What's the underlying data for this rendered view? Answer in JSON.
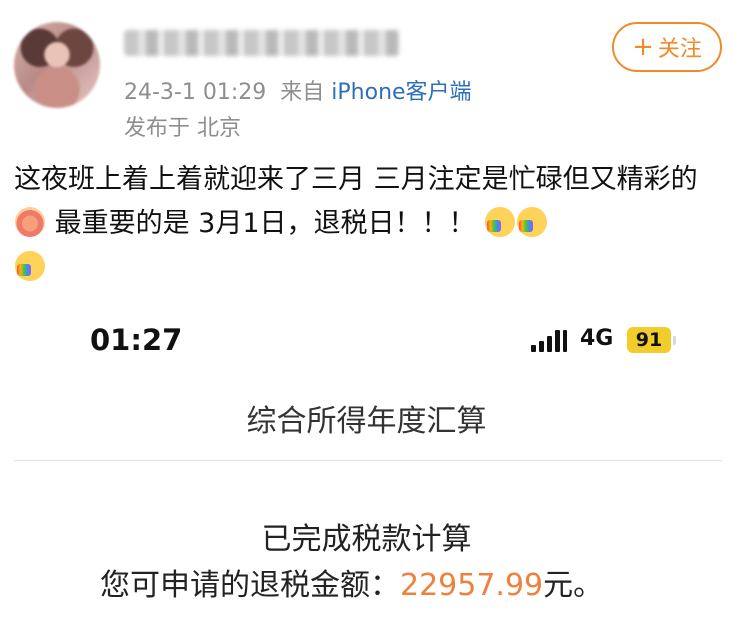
{
  "post_header": {
    "timestamp": "24-3-1 01:29",
    "from_label": "来自",
    "source": "iPhone客户端",
    "location": "发布于 北京",
    "follow_label": "关注",
    "follow_plus": "+"
  },
  "post": {
    "text_1": "这夜班上着上着就迎来了三月 三月注定是忙碌但又精彩的",
    "text_2": " 最重要的是 3月1日，退税日！！！ ",
    "emojis": [
      "flower-face-icon",
      "kiss-rainbow-icon",
      "kiss-rainbow-icon",
      "kiss-rainbow-icon"
    ]
  },
  "screenshot": {
    "status_bar": {
      "time": "01:27",
      "network": "4G",
      "battery": "91",
      "battery_color": "#f2cc2b"
    },
    "page_title": "综合所得年度汇算",
    "status_text": "已完成税款计算",
    "refund_label": "您可申请的退税金额：",
    "refund_amount": "22957.99",
    "refund_unit": "元。",
    "amount_color": "#f0803c"
  },
  "colors": {
    "follow_accent": "#f08a2b",
    "source_link": "#2f6fb7",
    "meta_gray": "#8e8e8e"
  }
}
